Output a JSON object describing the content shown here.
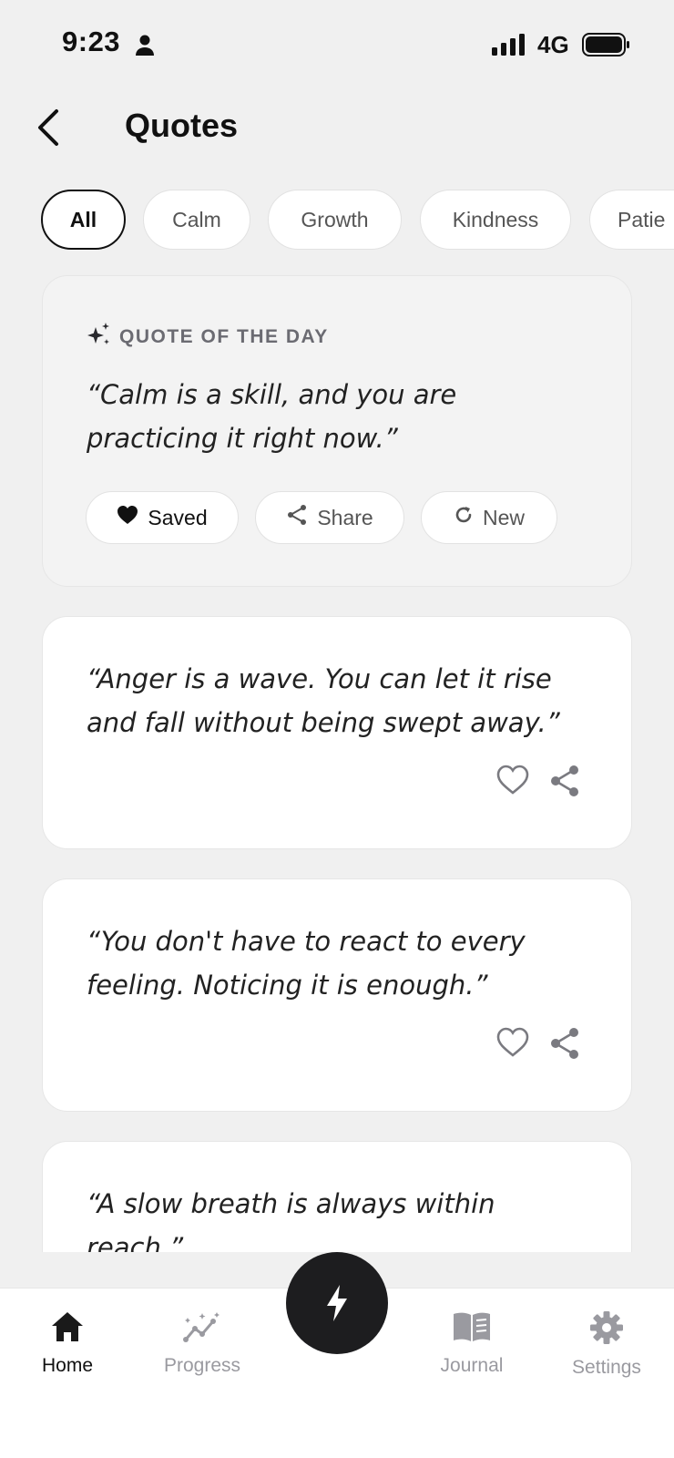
{
  "status_bar": {
    "time": "9:23",
    "network": "4G"
  },
  "header": {
    "title": "Quotes",
    "back_icon": "chevron-left-icon"
  },
  "filters": {
    "active": "All",
    "chips": [
      "All",
      "Calm",
      "Growth",
      "Kindness",
      "Patie"
    ]
  },
  "quote_of_day": {
    "label": "QUOTE OF THE DAY",
    "icon": "sparkle-icon",
    "text": "“Calm is a skill, and you are practicing it right now.”",
    "actions": {
      "saved": "Saved",
      "share": "Share",
      "new": "New"
    }
  },
  "quotes": [
    {
      "text": "“Anger is a wave. You can let it rise and fall without being swept away.”"
    },
    {
      "text": "“You don't have to react to every feeling. Noticing it is enough.”"
    },
    {
      "text": "“A slow breath is always within reach.”"
    }
  ],
  "nav": {
    "items": [
      {
        "label": "Home",
        "icon": "home-icon"
      },
      {
        "label": "Progress",
        "icon": "progress-chart-icon"
      },
      {
        "label": "Journal",
        "icon": "journal-book-icon"
      },
      {
        "label": "Settings",
        "icon": "gear-icon"
      }
    ],
    "fab_icon": "lightning-bolt-icon"
  },
  "colors": {
    "fab": "#1d1d1f",
    "active_text": "#111111",
    "inactive_text": "#9a9aa0",
    "background": "#f0f0f0"
  }
}
